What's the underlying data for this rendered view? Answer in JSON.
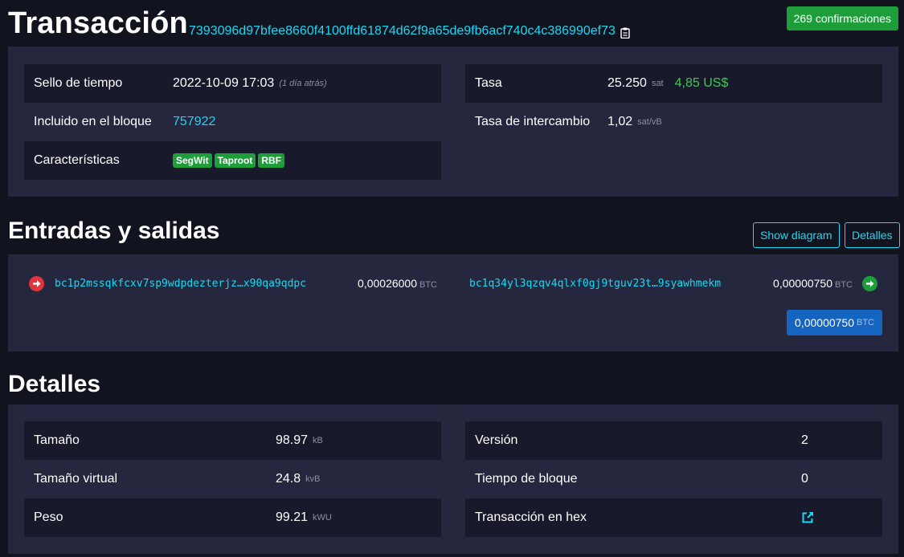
{
  "header": {
    "title": "Transacción",
    "txid": "7393096d97bfee8660f4100ffd61874d62f9a65de9fb6acf740c4c386990ef73",
    "confirmations": "269 confirmaciones"
  },
  "summary": {
    "left": [
      {
        "label": "Sello de tiempo",
        "value": "2022-10-09 17:03",
        "extra": "(1 día atrás)"
      },
      {
        "label": "Incluido en el bloque",
        "value": "757922"
      },
      {
        "label": "Características",
        "badges": [
          "SegWit",
          "Taproot",
          "RBF"
        ]
      }
    ],
    "right": [
      {
        "label": "Tasa",
        "value": "25.250",
        "unit": "sat",
        "usd": "4,85 US$"
      },
      {
        "label": "Tasa de intercambio",
        "value": "1,02",
        "unit": "sat/vB"
      }
    ]
  },
  "io": {
    "title": "Entradas y salidas",
    "show_diagram": "Show diagram",
    "details_btn": "Detalles",
    "input": {
      "address": "bc1p2mssqkfcxv7sp9wdpdezterjz…x90qa9qdpc",
      "amount": "0,00026000",
      "unit": "BTC"
    },
    "output": {
      "address": "bc1q34yl3qzqv4qlxf0gj9tguv23t…9syawhmekm",
      "amount": "0,00000750",
      "unit": "BTC"
    },
    "total": {
      "amount": "0,00000750",
      "unit": "BTC"
    }
  },
  "details": {
    "title": "Detalles",
    "left": [
      {
        "label": "Tamaño",
        "value": "98.97",
        "unit": "kB"
      },
      {
        "label": "Tamaño virtual",
        "value": "24.8",
        "unit": "kvB"
      },
      {
        "label": "Peso",
        "value": "99.21",
        "unit": "kWU"
      }
    ],
    "right": [
      {
        "label": "Versión",
        "value": "2"
      },
      {
        "label": "Tiempo de bloque",
        "value": "0"
      },
      {
        "label": "Transacción en hex",
        "icon": "external-link-icon"
      }
    ]
  },
  "colors": {
    "background": "#11131f",
    "panel": "#24273e",
    "row_dark": "#181a2b",
    "link": "#1bd8f4",
    "green": "#1e9e3a",
    "red": "#e0353f",
    "blue": "#1565c0"
  }
}
